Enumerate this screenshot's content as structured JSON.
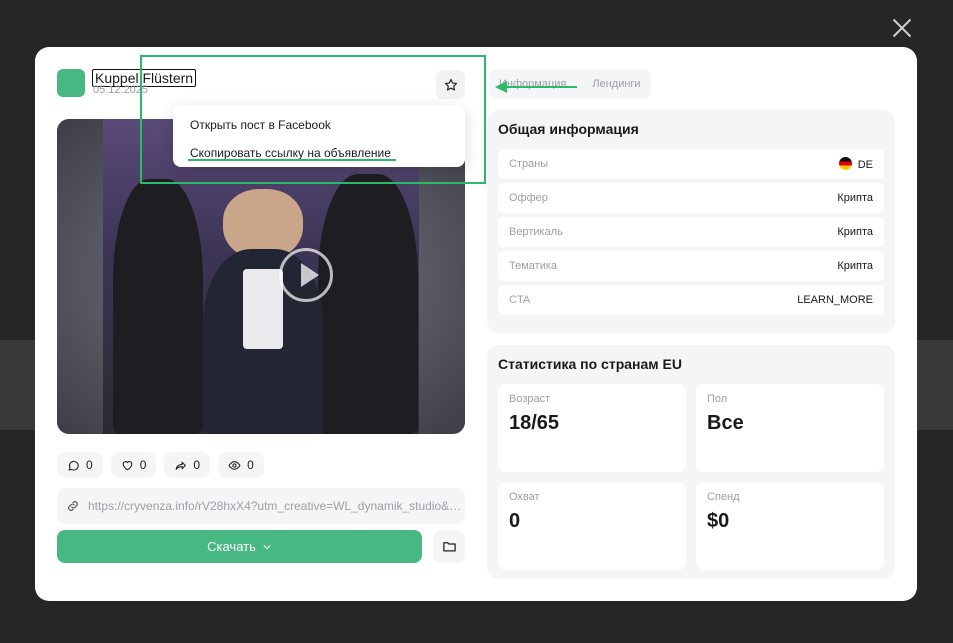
{
  "post": {
    "page_name": "Kuppel Flüstern",
    "date": "05.12.2025",
    "stats": [
      {
        "icon": "comment-icon",
        "value": "0"
      },
      {
        "icon": "heart-icon",
        "value": "0"
      },
      {
        "icon": "share-icon",
        "value": "0"
      },
      {
        "icon": "eye-icon",
        "value": "0"
      }
    ],
    "link": "https://cryvenza.info/rV28hxX4?utm_creative=WL_dynamik_studio&utm...",
    "download_label": "Скачать"
  },
  "dropdown": {
    "open_facebook": "Открыть пост в Facebook",
    "copy_link": "Скопировать ссылку на объявление"
  },
  "tabs": [
    "Информация",
    "Лендинги"
  ],
  "general_info": {
    "title": "Общая информация",
    "rows": [
      {
        "label": "Страны",
        "value": "DE"
      },
      {
        "label": "Оффер",
        "value": "Крипта"
      },
      {
        "label": "Вертикаль",
        "value": "Крипта"
      },
      {
        "label": "Тематика",
        "value": "Крипта"
      },
      {
        "label": "CTA",
        "value": "LEARN_MORE"
      }
    ]
  },
  "eu_stats": {
    "title": "Статистика по странам EU",
    "cards": [
      {
        "label": "Возраст",
        "value": "18/65"
      },
      {
        "label": "Пол",
        "value": "Все"
      },
      {
        "label": "Охват",
        "value": "0"
      },
      {
        "label": "Спенд",
        "value": "$0"
      }
    ]
  },
  "colors": {
    "accent": "#47b881",
    "annotation": "#2eb86b"
  }
}
